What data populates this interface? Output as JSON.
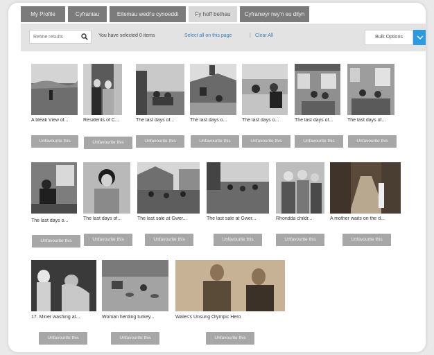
{
  "tabs": [
    {
      "label": "My Profile",
      "active": false
    },
    {
      "label": "Cyfraniau",
      "active": false
    },
    {
      "label": "Eitemau wedi'u cynoeddi",
      "active": false
    },
    {
      "label": "Fy hoff bethau",
      "active": true
    },
    {
      "label": "Cyfranwyr rwy'n eu dilyn",
      "active": false
    }
  ],
  "toolbar": {
    "search_placeholder": "Refine results",
    "selected_text": "You have selected 0 items",
    "select_all_label": "Select all on this page",
    "separator": "|",
    "clear_all_label": "Clear All",
    "bulk_options_label": "Bulk Options"
  },
  "items": [
    {
      "caption": "A bleak View of...",
      "button": "Unfavourite this"
    },
    {
      "caption": "Residents of C...",
      "button": "Unfavourite this"
    },
    {
      "caption": "The last days of...",
      "button": "Unfavourite this"
    },
    {
      "caption": "The last days o...",
      "button": "Unfavourite this"
    },
    {
      "caption": "The last days o...",
      "button": "Unfavourite this"
    },
    {
      "caption": "The last days of...",
      "button": "Unfavourite this"
    },
    {
      "caption": "The last days of...",
      "button": "Unfavourite this"
    },
    {
      "caption": "The last days o...",
      "button": "Unfavourite this"
    },
    {
      "caption": "The last days of...",
      "button": "Unfavourite this"
    },
    {
      "caption": "The last sale at Gwer...",
      "button": "Unfavourite this"
    },
    {
      "caption": "The last sale at Gwer...",
      "button": "Unfavourite this"
    },
    {
      "caption": "Rhondda childr...",
      "button": "Unfavourite this"
    },
    {
      "caption": "A mother waits on the d...",
      "button": "Unfavourite this"
    },
    {
      "caption": "17. Miner washing at...",
      "button": "Unfavourite this"
    },
    {
      "caption": "Woman herding turkey...",
      "button": "Unfavourite this"
    },
    {
      "caption": "Wales's Unsung Olympic Hero",
      "button": "Unfavourite this"
    }
  ],
  "colors": {
    "tab_bg": "#7b7b7b",
    "tab_active_bg": "#d8d8d8",
    "link": "#2f7fbf",
    "bulk_arrow": "#2b9ae0",
    "unfavourite_button": "#a7a7a7"
  }
}
